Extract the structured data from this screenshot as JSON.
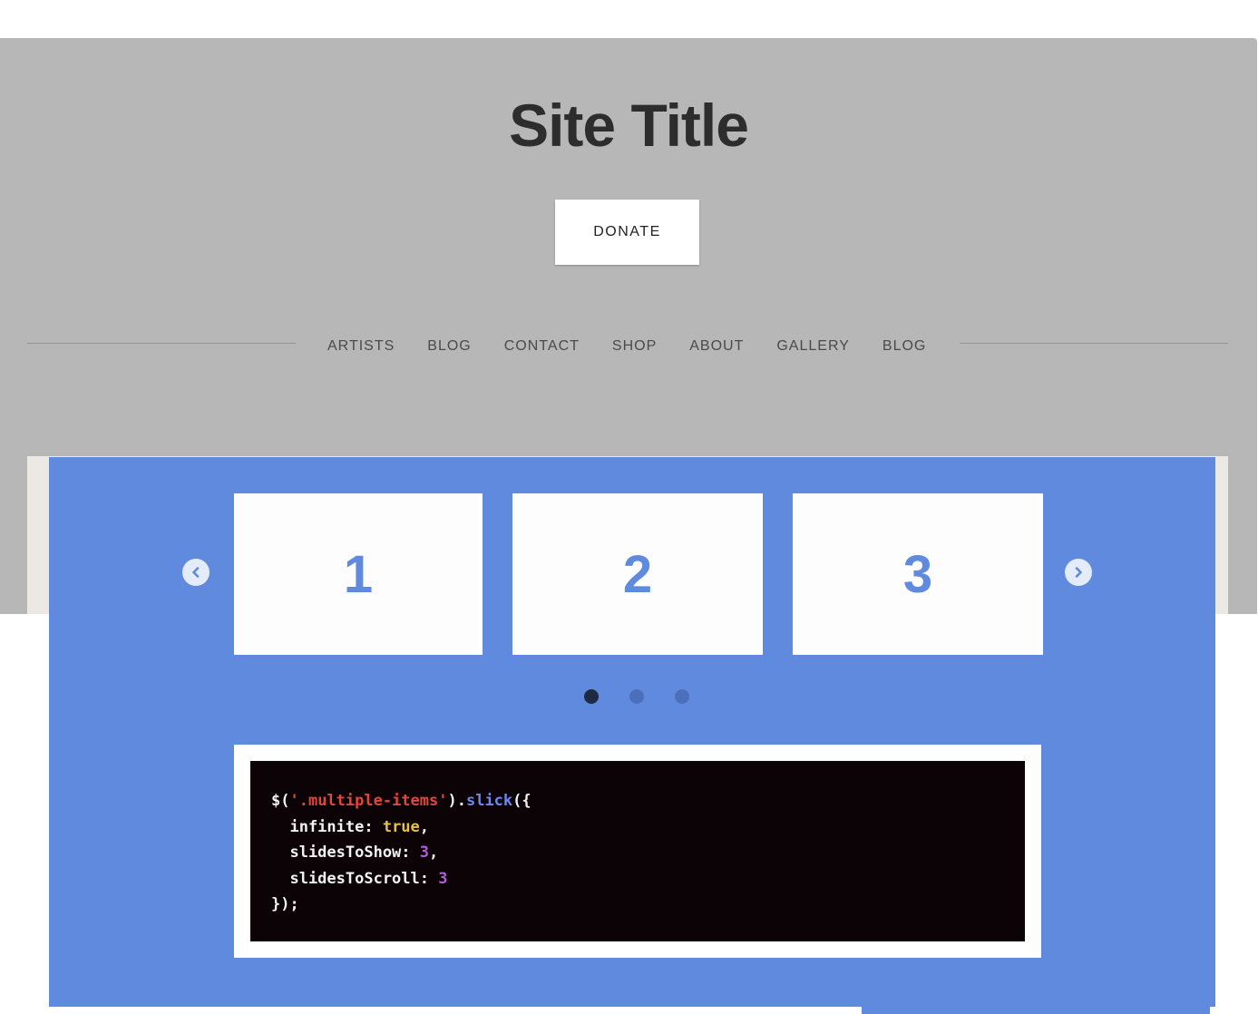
{
  "header": {
    "site_title": "Site Title",
    "donate_label": "DONATE",
    "nav_items": [
      "ARTISTS",
      "BLOG",
      "CONTACT",
      "SHOP",
      "ABOUT",
      "GALLERY",
      "BLOG"
    ]
  },
  "carousel": {
    "slides": [
      "1",
      "2",
      "3"
    ],
    "prev_icon": "chevron-left-icon",
    "next_icon": "chevron-right-icon",
    "dots_count": 3,
    "active_dot": 0
  },
  "code": {
    "line1": {
      "p1": "$(",
      "p2": "'.multiple-items'",
      "p3": ").",
      "p4": "slick",
      "p5": "({"
    },
    "line2": {
      "p1": "  infinite: ",
      "p2": "true",
      "p3": ","
    },
    "line3": {
      "p1": "  slidesToShow: ",
      "p2": "3",
      "p3": ","
    },
    "line4": {
      "p1": "  slidesToScroll: ",
      "p2": "3"
    },
    "line5": {
      "p1": "});"
    }
  },
  "colors": {
    "header_bg": "#b7b7b7",
    "panel_bg": "#5f8ade",
    "code_bg": "#0b0306",
    "slide_number": "#5f8ade"
  }
}
